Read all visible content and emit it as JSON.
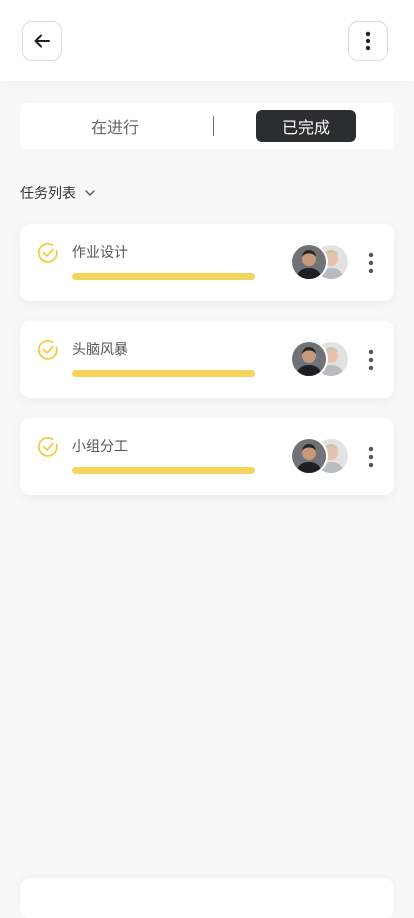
{
  "header": {
    "back_icon": "arrow-left-icon",
    "more_icon": "vertical-dots-icon"
  },
  "tabs": {
    "in_progress": "在进行",
    "completed": "已完成",
    "active": "completed"
  },
  "filter": {
    "label": "任务列表",
    "icon": "chevron-down-icon"
  },
  "tasks": [
    {
      "title": "作业设计",
      "progress": 1.0
    },
    {
      "title": "头脑风暴",
      "progress": 1.0
    },
    {
      "title": "小组分工",
      "progress": 1.0
    }
  ],
  "colors": {
    "accent_yellow": "#f5d35c",
    "active_tab_bg": "#2c2d2f"
  }
}
